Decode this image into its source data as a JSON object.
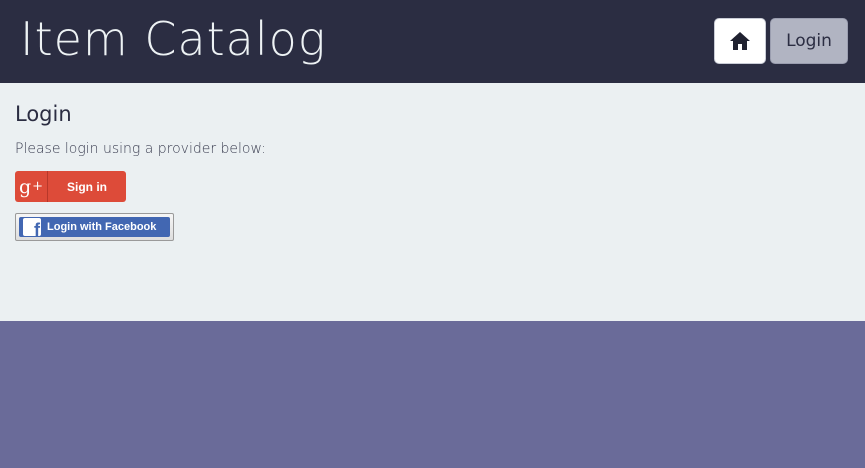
{
  "header": {
    "title": "Item Catalog",
    "home_icon": "home-icon",
    "login_label": "Login"
  },
  "main": {
    "heading": "Login",
    "instructions": "Please login using a provider below:",
    "google": {
      "logo_text": "g",
      "logo_plus": "+",
      "label": "Sign in"
    },
    "facebook": {
      "logo_text": "f",
      "label": "Login with Facebook"
    }
  },
  "colors": {
    "header_bg": "#2b2d42",
    "content_bg": "#ebf0f2",
    "footer_bg": "#6a6b99",
    "google_red": "#dd4b39",
    "facebook_blue": "#4267b2"
  }
}
